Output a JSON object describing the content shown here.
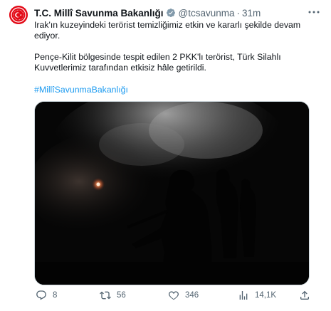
{
  "tweet": {
    "display_name": "T.C. Millî Savunma Bakanlığı",
    "handle": "@tcsavunma",
    "separator": "·",
    "time": "31m",
    "paragraph1": "Irak'ın kuzeyindeki terörist temizliğimiz etkin ve kararlı şekilde devam ediyor.",
    "paragraph2": "Pençe-Kilit bölgesinde tespit edilen 2 PKK'lı terörist, Türk Silahlı Kuvvetlerimiz tarafından etkisiz hâle getirildi.",
    "hashtag": "#MillîSavunmaBakanlığı"
  },
  "actions": {
    "replies": "8",
    "retweets": "56",
    "likes": "346",
    "views": "14,1K"
  },
  "colors": {
    "text": "#0f1419",
    "secondary": "#536471",
    "link": "#1d9bf0",
    "verified": "#829aab",
    "avatar": "#e30a17"
  },
  "icons": {
    "verified": "verified-badge-icon",
    "more": "more-options-icon",
    "reply": "reply-icon",
    "retweet": "retweet-icon",
    "like": "heart-icon",
    "views": "views-icon",
    "share": "share-icon"
  }
}
